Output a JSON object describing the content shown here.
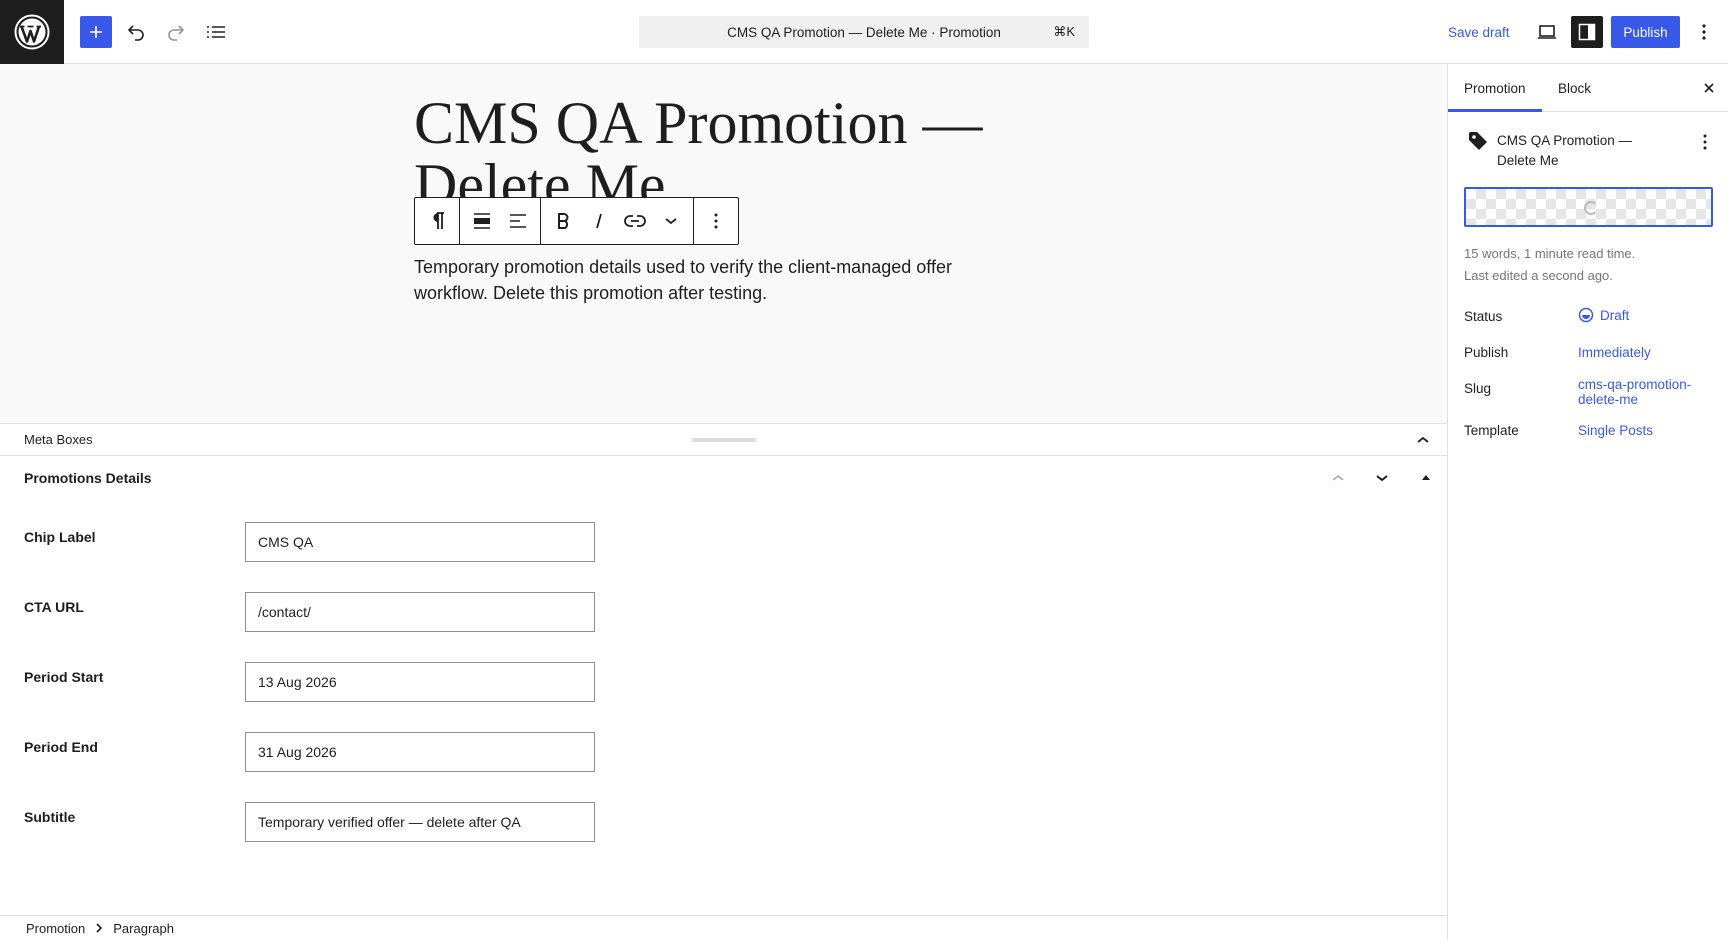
{
  "header": {
    "command_title": "CMS QA Promotion — Delete Me · Promotion",
    "shortcut": "⌘K",
    "save_draft": "Save draft",
    "publish": "Publish"
  },
  "post": {
    "title": "CMS QA Promotion — Delete Me",
    "paragraph": "Temporary promotion details used to verify the client-managed offer workflow. Delete this promotion after testing."
  },
  "meta": {
    "header_label": "Meta Boxes",
    "box_title": "Promotions Details",
    "fields": [
      {
        "label": "Chip Label",
        "value": "CMS QA"
      },
      {
        "label": "CTA URL",
        "value": "/contact/"
      },
      {
        "label": "Period Start",
        "value": "13 Aug 2026"
      },
      {
        "label": "Period End",
        "value": "31 Aug 2026"
      },
      {
        "label": "Subtitle",
        "value": "Temporary verified offer — delete after QA"
      }
    ]
  },
  "breadcrumb": {
    "items": [
      "Promotion",
      "Paragraph"
    ]
  },
  "sidebar": {
    "tabs": [
      "Promotion",
      "Block"
    ],
    "post_title": "CMS QA Promotion — Delete Me",
    "word_count": "15 words, 1 minute read time.",
    "last_edited": "Last edited a second ago.",
    "rows": [
      {
        "label": "Status",
        "value": "Draft"
      },
      {
        "label": "Publish",
        "value": "Immediately"
      },
      {
        "label": "Slug",
        "value": "cms-qa-promotion-delete-me"
      },
      {
        "label": "Template",
        "value": "Single Posts"
      }
    ]
  },
  "colors": {
    "accent": "#3858e9",
    "dark": "#1e1e1e"
  }
}
